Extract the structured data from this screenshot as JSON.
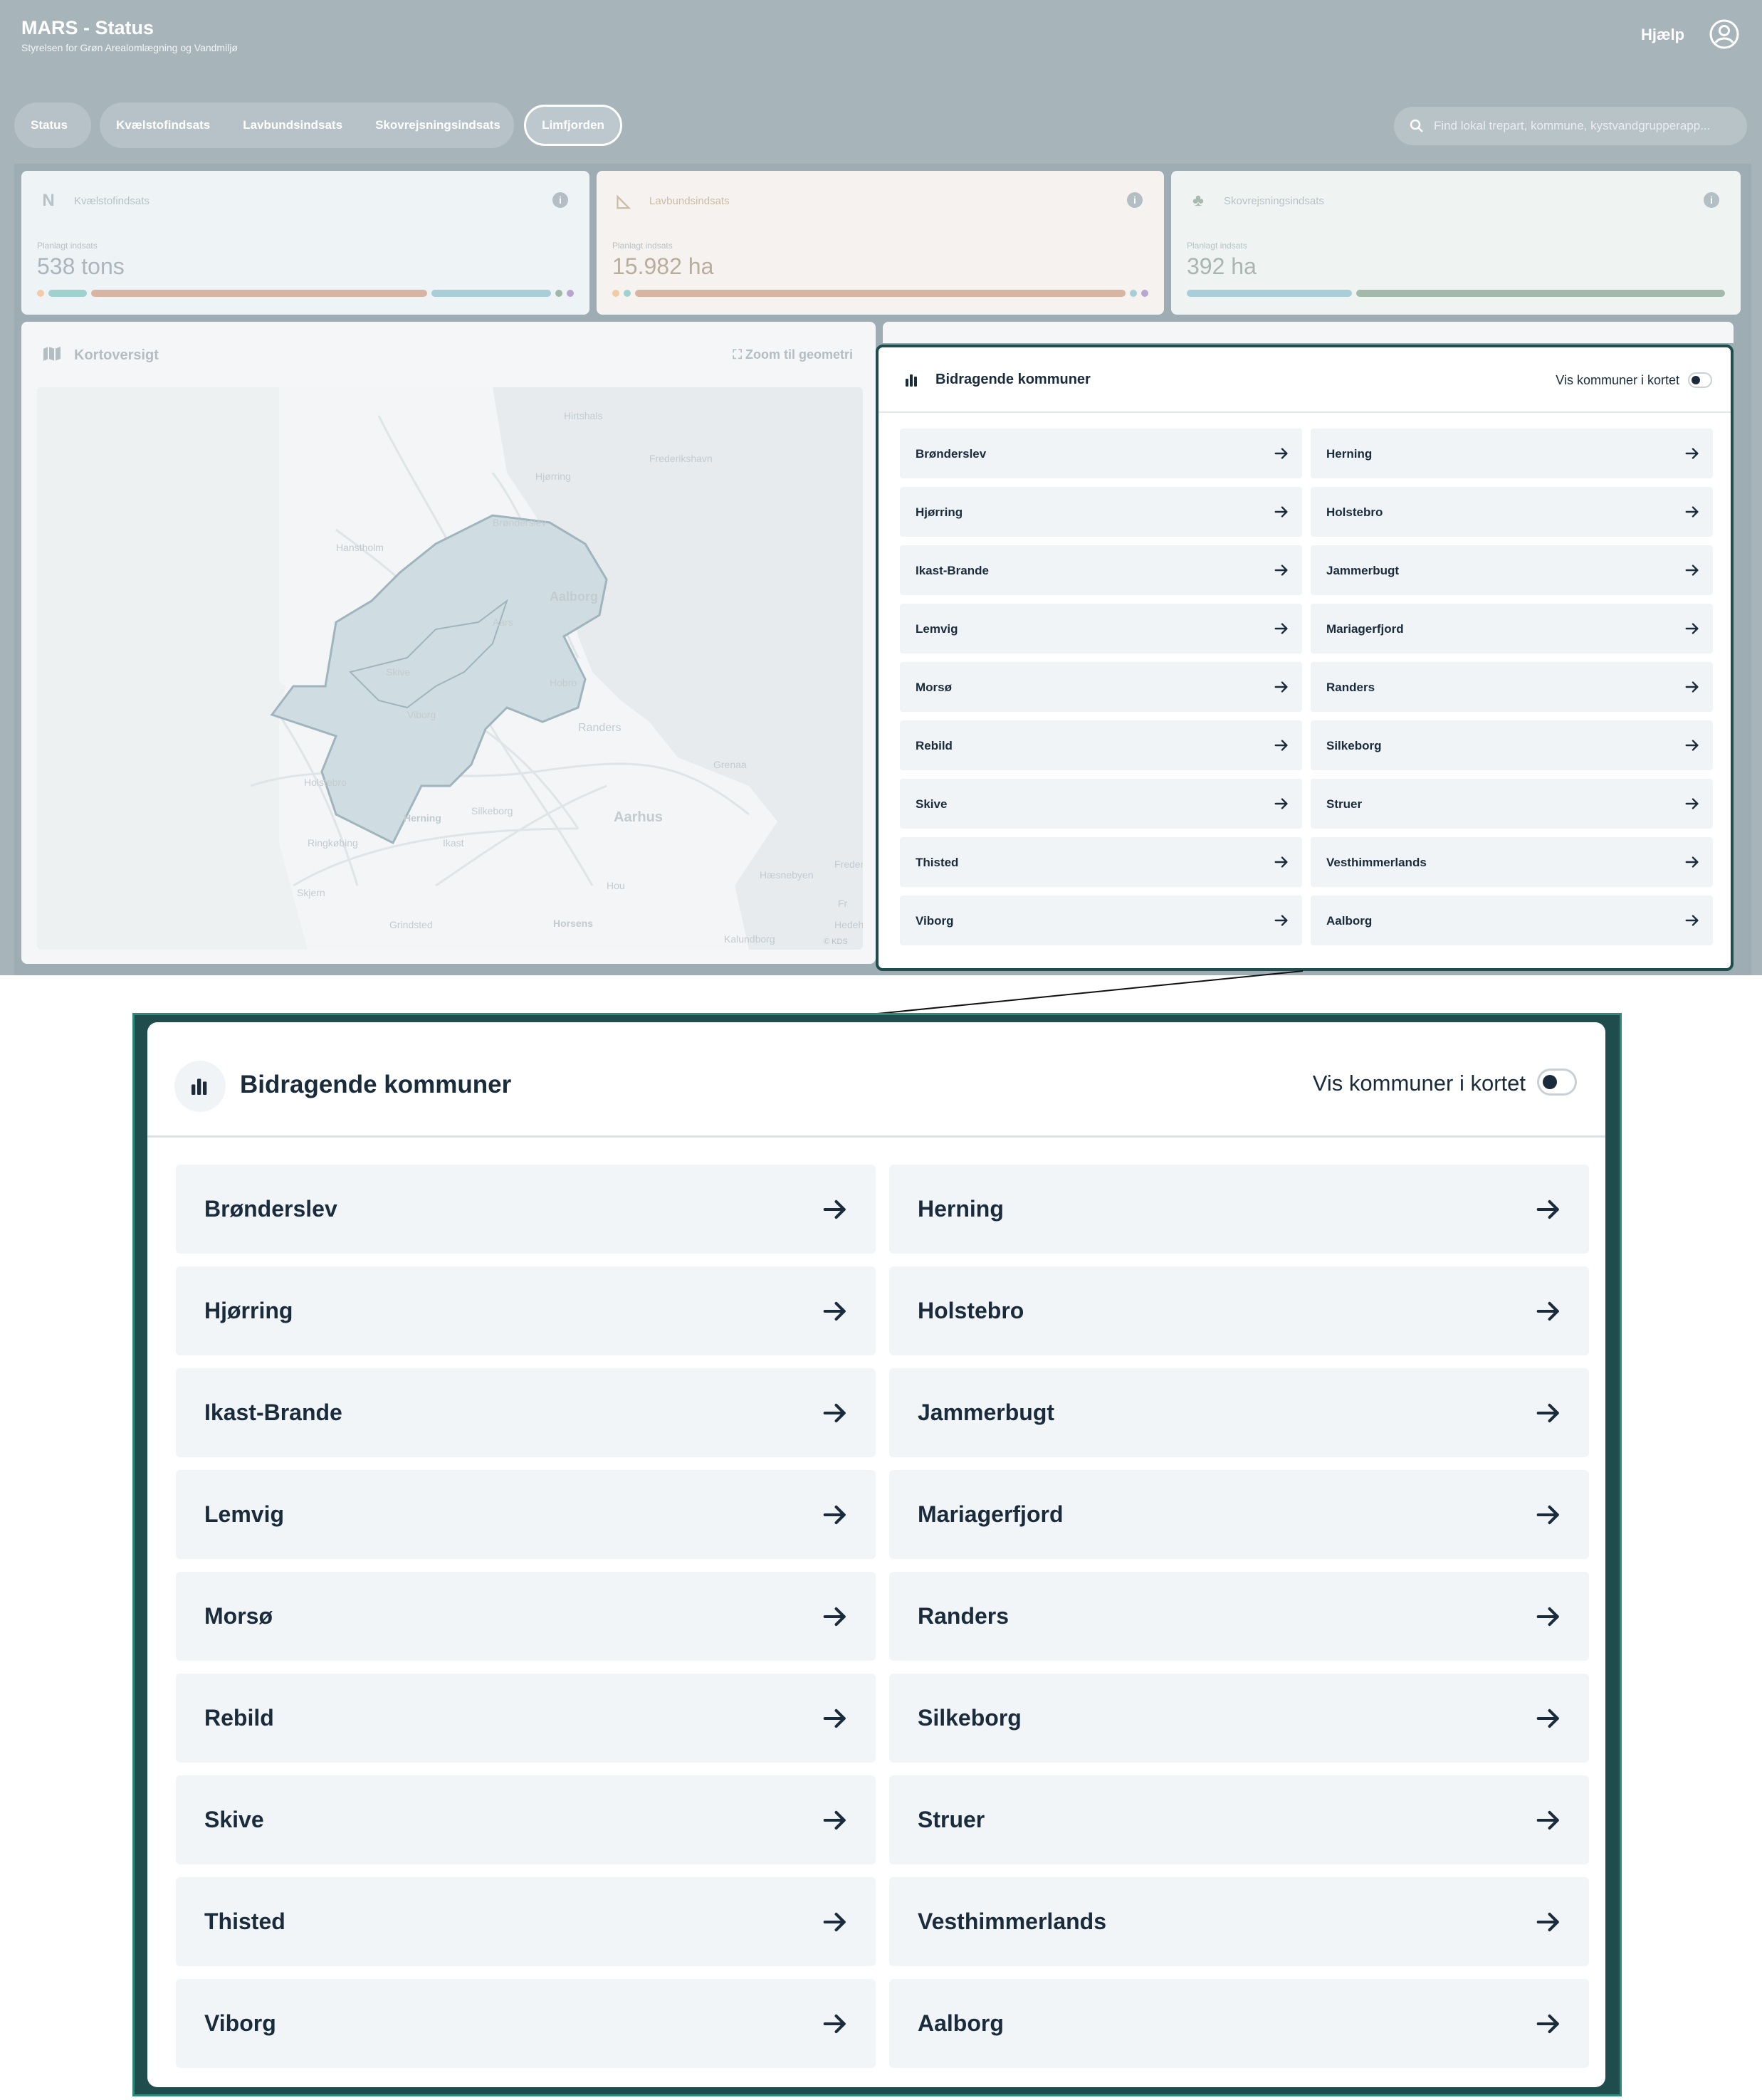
{
  "header": {
    "app_title": "MARS - Status",
    "subtitle": "Styrelsen for Grøn Arealomlægning og Vandmiljø",
    "help_label": "Hjælp",
    "user_icon": "user-circle-icon"
  },
  "nav": {
    "tab_status": "Status",
    "tab_kvaelstof": "Kvælstofindsats",
    "tab_lavbund": "Lavbundsindsats",
    "tab_skov": "Skovrejsningsindsats",
    "tab_limfjorden": "Limfjorden",
    "active_tab": "Limfjorden"
  },
  "search": {
    "placeholder": "Find lokal trepart, kommune, kystvandgrupperapp..."
  },
  "cards": [
    {
      "icon_text": "N",
      "title": "Kvælstofindsats",
      "label": "Planlagt indsats",
      "value": "538 tons",
      "icon": "nitrogen-icon",
      "bar_colors": [
        "#f1cba6",
        "#9fd2cf",
        "#d8b5a2",
        "#a9cdd9",
        "#9fb8a7",
        "#b9a6cf"
      ]
    },
    {
      "icon_text": "◺",
      "title": "Lavbundsindsats",
      "label": "Planlagt indsats",
      "value": "15.982 ha",
      "icon": "ruler-triangle-icon",
      "bar_colors": [
        "#f1cba6",
        "#9fd2cf",
        "#d8b5a2",
        "#a9cdd9",
        "#b9a6cf"
      ]
    },
    {
      "icon_text": "♣",
      "title": "Skovrejsningsindsats",
      "label": "Planlagt indsats",
      "value": "392 ha",
      "icon": "trees-icon",
      "bar_colors": [
        "#a9cdd9",
        "#a3b9ab"
      ]
    }
  ],
  "map": {
    "title": "Kortoversigt",
    "zoom_label": "Zoom til geometri",
    "attribution": "© KDS",
    "places": [
      "Hirtshals",
      "Frederikshavn",
      "Hjørring",
      "Brønderslev",
      "Hanstholm",
      "Aalborg",
      "Aars",
      "Hobro",
      "Skive",
      "Randers",
      "Grenaa",
      "Holstebro",
      "Herning",
      "Silkeborg",
      "Aarhus",
      "Ringkøbing",
      "Ikast",
      "Skjern",
      "Hou",
      "Fredericia",
      "Grindsted",
      "Horsens",
      "Kalundborg",
      "Hæsnebyen",
      "Hedehusene",
      "Viborg",
      "Fr"
    ]
  },
  "kommuner": {
    "title": "Bidragende kommuner",
    "toggle_label": "Vis kommuner i kortet",
    "toggle_on": true,
    "items": [
      "Brønderslev",
      "Herning",
      "Hjørring",
      "Holstebro",
      "Ikast-Brande",
      "Jammerbugt",
      "Lemvig",
      "Mariagerfjord",
      "Morsø",
      "Randers",
      "Rebild",
      "Silkeborg",
      "Skive",
      "Struer",
      "Thisted",
      "Vesthimmerlands",
      "Viborg",
      "Aalborg"
    ]
  },
  "colors": {
    "accent_border": "#1f4c4c",
    "text_dark": "#1a2b3c",
    "item_bg": "#f1f4f6"
  }
}
